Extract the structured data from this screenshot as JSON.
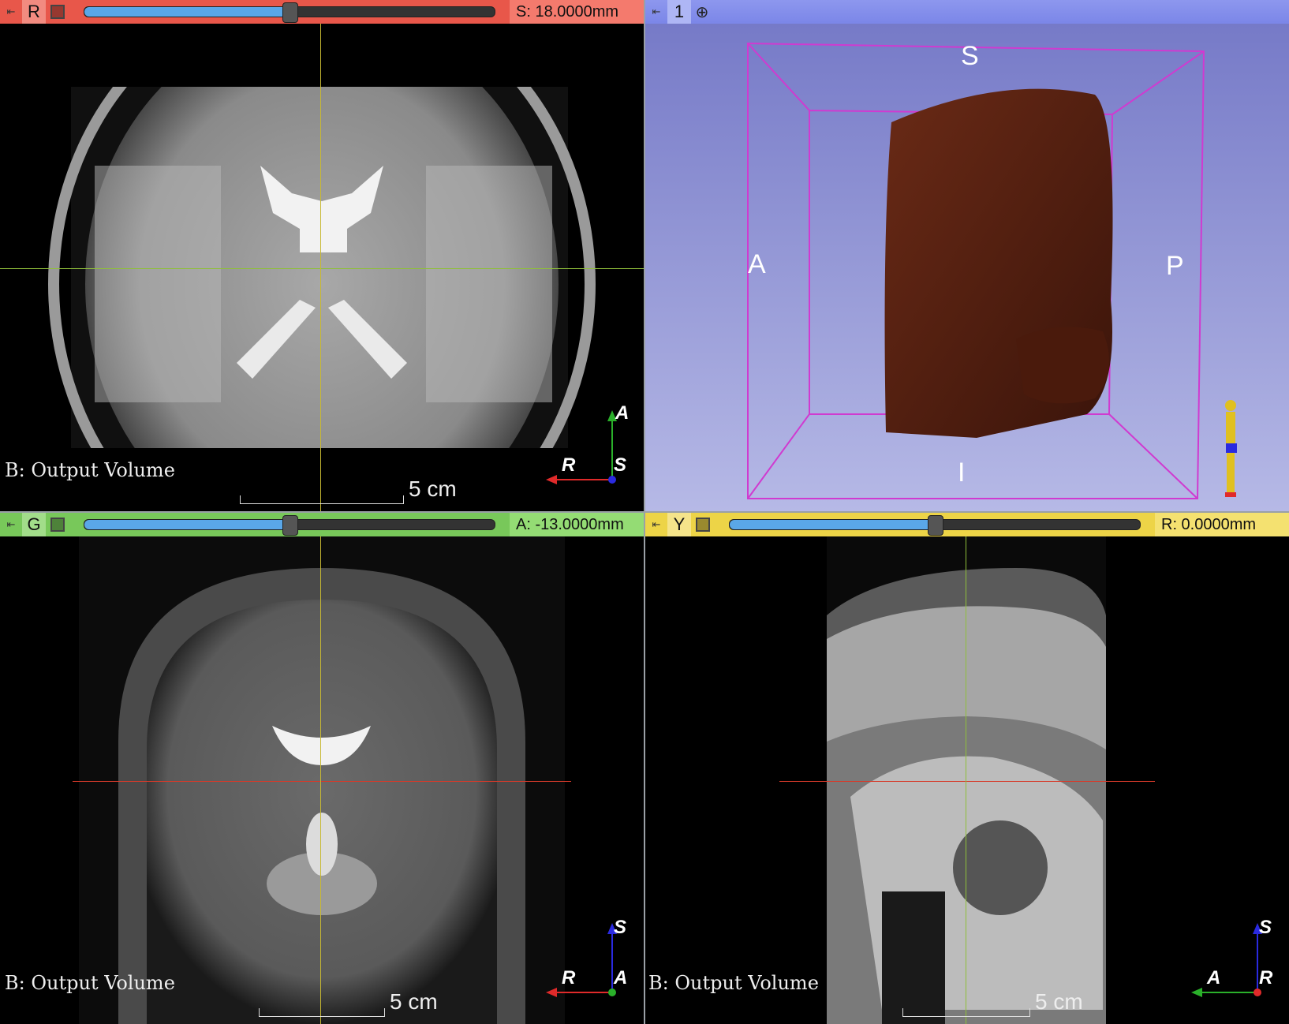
{
  "views": {
    "red": {
      "label": "R",
      "value": "S: 18.0000mm",
      "slider_fraction": 0.5,
      "volume_label": "B: Output Volume",
      "scale": "5 cm",
      "axes": [
        "A",
        "R",
        "S"
      ],
      "color": "#e8574a"
    },
    "threed": {
      "label": "1",
      "box_labels": [
        "S",
        "A",
        "P",
        "I"
      ],
      "color": "#8d97ee"
    },
    "green": {
      "label": "G",
      "value": "A: -13.0000mm",
      "slider_fraction": 0.5,
      "volume_label": "B: Output Volume",
      "scale": "5 cm",
      "axes": [
        "S",
        "R",
        "A"
      ],
      "color": "#78c85a"
    },
    "yellow": {
      "label": "Y",
      "value": "R: 0.0000mm",
      "slider_fraction": 0.5,
      "volume_label": "B: Output Volume",
      "scale": "5 cm",
      "axes": [
        "S",
        "A",
        "R"
      ],
      "color": "#edd447"
    }
  },
  "icons": {
    "pin": "pin-icon",
    "link": "link-icon",
    "center": "crosshair-icon"
  }
}
